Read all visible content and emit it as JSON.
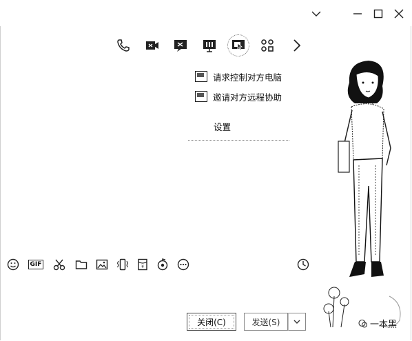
{
  "window": {
    "controls": [
      "minimize-chevron",
      "minimize",
      "maximize",
      "close"
    ]
  },
  "toolbar": {
    "icons": [
      "phone-icon",
      "video-call-icon",
      "screen-share-icon",
      "whiteboard-icon",
      "remote-assist-icon",
      "apps-icon",
      "more-chevron-icon"
    ]
  },
  "remote_menu": {
    "request_control": "请求控制对方电脑",
    "invite_assist": "邀请对方远程协助",
    "settings": "设置"
  },
  "input_toolbar": {
    "gif_label": "GIF",
    "icons": [
      "emoji-icon",
      "gif-icon",
      "scissors-icon",
      "folder-icon",
      "image-icon",
      "vibrate-icon",
      "red-envelope-icon",
      "music-icon",
      "more-icon",
      "history-clock-icon"
    ]
  },
  "buttons": {
    "close_label": "关闭(C)",
    "send_label": "发送(S)"
  },
  "watermark": {
    "text": "一本黑"
  }
}
